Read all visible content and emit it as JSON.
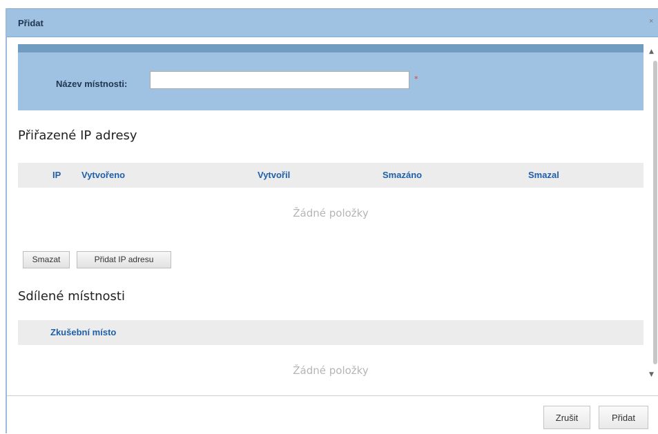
{
  "dialog": {
    "title": "Přidat",
    "close_label": "×"
  },
  "form": {
    "room_name_label": "Název místnosti:",
    "room_name_value": "",
    "required_marker": "*"
  },
  "ip_section": {
    "title": "Přiřazené IP adresy",
    "columns": [
      "IP",
      "Vytvořeno",
      "Vytvořil",
      "Smazáno",
      "Smazal"
    ],
    "empty_text": "Žádné položky",
    "delete_label": "Smazat",
    "add_ip_label": "Přidat IP adresu"
  },
  "shared_section": {
    "title": "Sdílené místnosti",
    "columns": [
      "Zkušební místo"
    ],
    "empty_text": "Žádné položky"
  },
  "footer": {
    "cancel_label": "Zrušit",
    "add_label": "Přidat"
  },
  "scrollbar": {
    "up_icon": "▲",
    "down_icon": "▼"
  },
  "colors": {
    "title_bar": "#9fc2e2",
    "panel_stripe": "#6f9cc0",
    "grid_header_text": "#1f5fa8",
    "required": "#e23b3b"
  }
}
